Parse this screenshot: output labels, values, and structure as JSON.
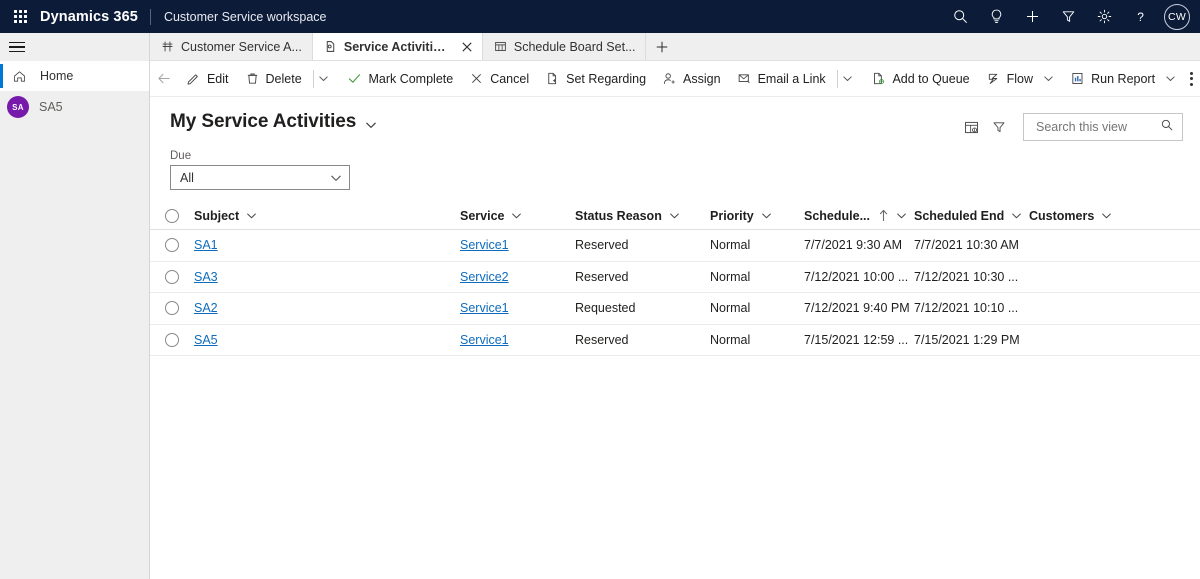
{
  "appbar": {
    "waffle_icon": "app-launcher-icon",
    "brand": "Dynamics 365",
    "app_name": "Customer Service workspace",
    "icons": [
      {
        "name": "search-icon",
        "label": "Search"
      },
      {
        "name": "lightbulb-icon",
        "label": "Insights"
      },
      {
        "name": "plus-icon",
        "label": "Quick create"
      },
      {
        "name": "filter-funnel-icon",
        "label": "Filter"
      },
      {
        "name": "gear-icon",
        "label": "Settings"
      },
      {
        "name": "help-question-icon",
        "label": "Help"
      }
    ],
    "avatar_initials": "CW",
    "background_color": "#0b1b38"
  },
  "sidebar": {
    "hamburger_label": "Site map",
    "items": [
      {
        "icon": "home-icon",
        "label": "Home",
        "selected": true
      },
      {
        "icon": "user-avatar",
        "label": "SA5",
        "avatar_initials": "SA",
        "avatar_color": "#7719aa",
        "selected": false
      }
    ]
  },
  "tabs": {
    "items": [
      {
        "label": "Customer Service A...",
        "icon": "customer-service-hub-icon",
        "active": false,
        "closable": false
      },
      {
        "label": "Service Activities My Ser...",
        "icon": "service-activity-icon",
        "active": true,
        "closable": true
      },
      {
        "label": "Schedule Board Set...",
        "icon": "schedule-board-icon",
        "active": false,
        "closable": false
      }
    ],
    "new_tab_label": "+"
  },
  "commandbar": {
    "back_label": "Back",
    "commands": [
      {
        "label": "Edit",
        "icon": "pencil-icon",
        "caret": false
      },
      {
        "label": "Delete",
        "icon": "trash-icon",
        "caret": true,
        "separator_before": true
      },
      {
        "label": "Mark Complete",
        "icon": "checkmark-icon",
        "caret": false
      },
      {
        "label": "Cancel",
        "icon": "cross-icon",
        "caret": false
      },
      {
        "label": "Set Regarding",
        "icon": "document-add-icon",
        "caret": false
      },
      {
        "label": "Assign",
        "icon": "person-add-icon",
        "caret": false
      },
      {
        "label": "Email a Link",
        "icon": "email-link-icon",
        "caret": true,
        "separator_before": true
      },
      {
        "label": "Add to Queue",
        "icon": "queue-add-icon",
        "caret": false
      },
      {
        "label": "Flow",
        "icon": "flow-icon",
        "caret": true
      },
      {
        "label": "Run Report",
        "icon": "report-icon",
        "caret": true
      }
    ],
    "overflow_label": "More commands"
  },
  "view": {
    "title": "My Service Activities",
    "title_caret_label": "Change view",
    "chart_icon_label": "Show chart",
    "filter_icon_label": "Edit filters",
    "search": {
      "placeholder": "Search this view",
      "value": "",
      "icon": "search-icon"
    }
  },
  "filter": {
    "label": "Due",
    "value": "All"
  },
  "grid": {
    "columns": [
      {
        "key": "subject",
        "label": "Subject",
        "sorted": false
      },
      {
        "key": "service",
        "label": "Service",
        "sorted": false
      },
      {
        "key": "status_reason",
        "label": "Status Reason",
        "sorted": false
      },
      {
        "key": "priority",
        "label": "Priority",
        "sorted": false
      },
      {
        "key": "scheduled_start",
        "label": "Schedule...",
        "sorted": true,
        "sort_direction": "asc"
      },
      {
        "key": "scheduled_end",
        "label": "Scheduled End",
        "sorted": false
      },
      {
        "key": "customers",
        "label": "Customers",
        "sorted": false
      }
    ],
    "rows": [
      {
        "subject": "SA1",
        "service": "Service1",
        "status_reason": "Reserved",
        "priority": "Normal",
        "scheduled_start": "7/7/2021 9:30 AM",
        "scheduled_end": "7/7/2021 10:30 AM",
        "customers": ""
      },
      {
        "subject": "SA3",
        "service": "Service2",
        "status_reason": "Reserved",
        "priority": "Normal",
        "scheduled_start": "7/12/2021 10:00 ...",
        "scheduled_end": "7/12/2021 10:30 ...",
        "customers": ""
      },
      {
        "subject": "SA2",
        "service": "Service1",
        "status_reason": "Requested",
        "priority": "Normal",
        "scheduled_start": "7/12/2021 9:40 PM",
        "scheduled_end": "7/12/2021 10:10 ...",
        "customers": ""
      },
      {
        "subject": "SA5",
        "service": "Service1",
        "status_reason": "Reserved",
        "priority": "Normal",
        "scheduled_start": "7/15/2021 12:59 ...",
        "scheduled_end": "7/15/2021 1:29 PM",
        "customers": ""
      }
    ]
  },
  "colors": {
    "link": "#0f6cbd",
    "accent": "#0078d4",
    "appbar": "#0b1b38",
    "sidebar": "#efefef",
    "avatar_purple": "#7719aa"
  }
}
